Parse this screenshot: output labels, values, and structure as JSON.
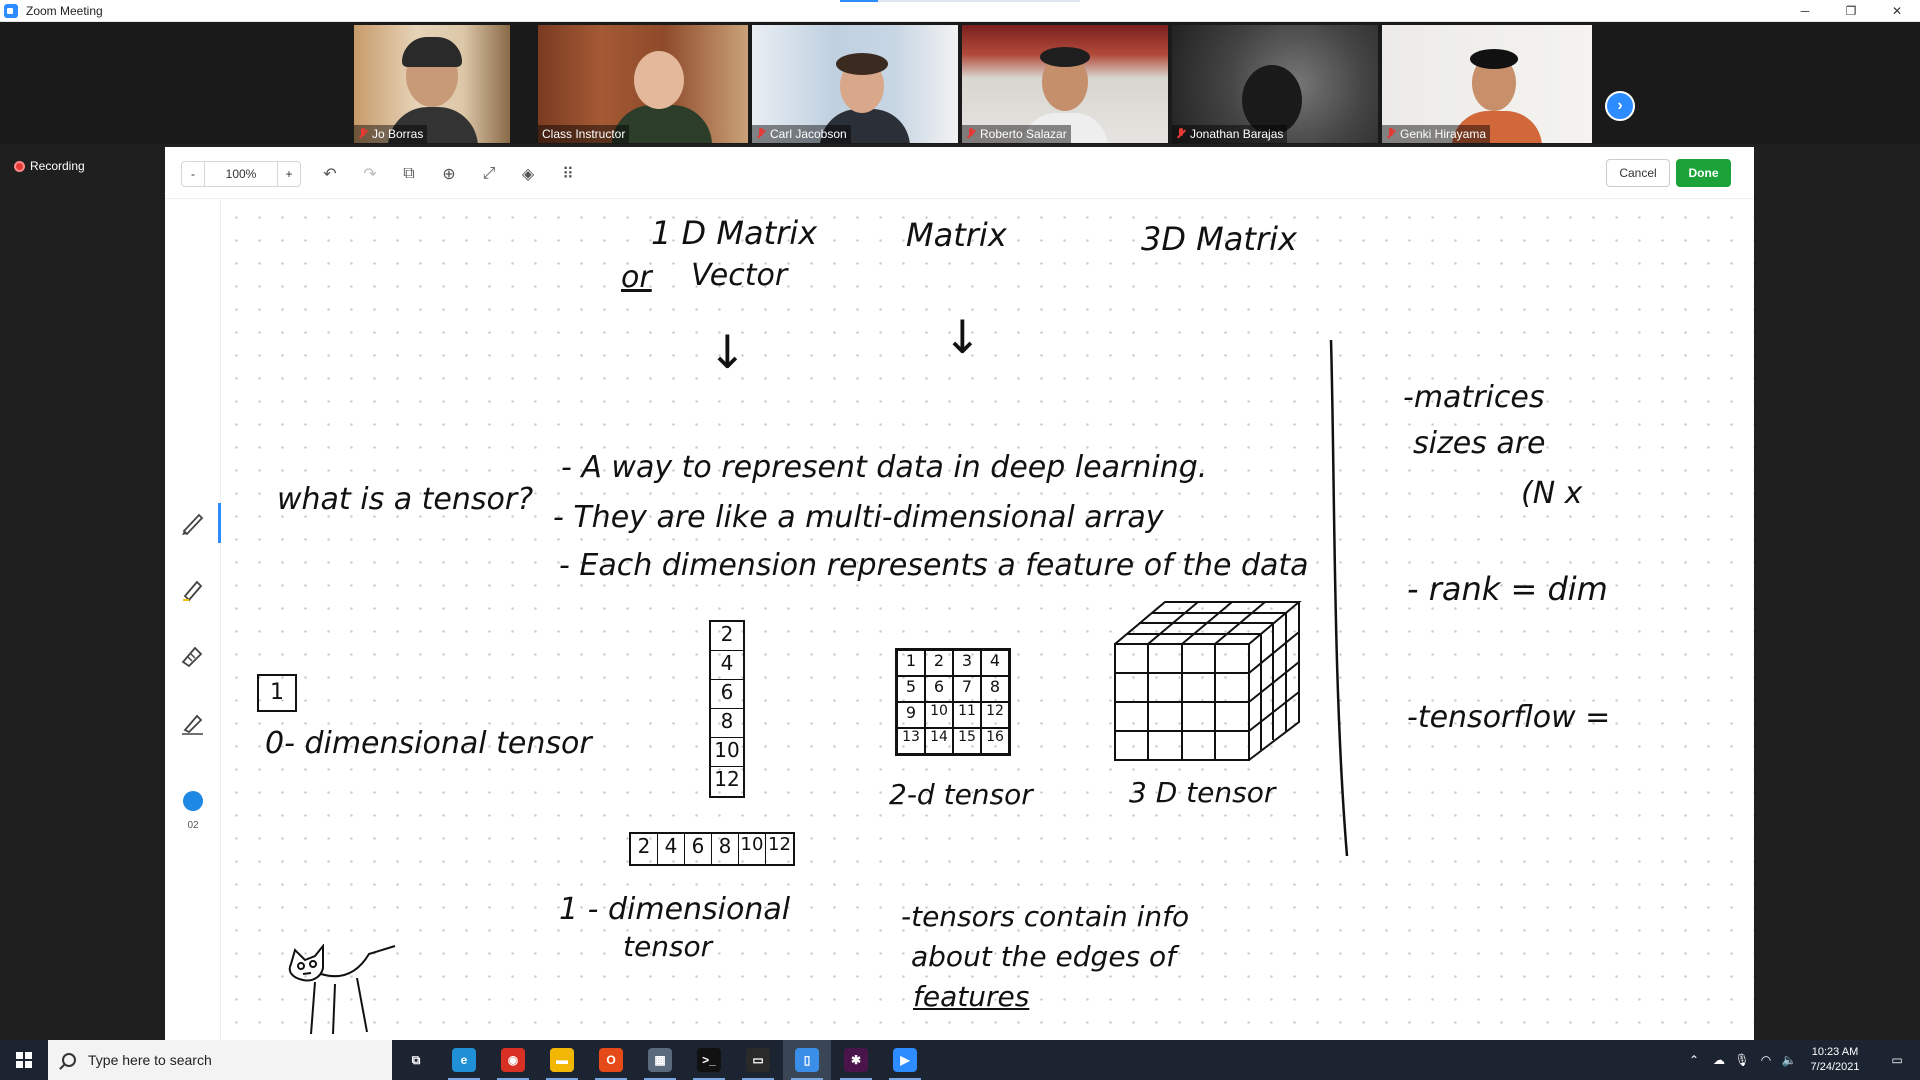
{
  "window": {
    "title": "Zoom Meeting",
    "loading_fraction": 0.16
  },
  "window_controls": {
    "minimize": "─",
    "restore": "❐",
    "close": "✕"
  },
  "participants": [
    {
      "name": "Jo Borras",
      "muted": true,
      "active": false
    },
    {
      "name": "Class Instructor",
      "muted": false,
      "active": true
    },
    {
      "name": "Carl Jacobson",
      "muted": true,
      "active": false
    },
    {
      "name": "Roberto Salazar",
      "muted": true,
      "active": false
    },
    {
      "name": "Jonathan Barajas",
      "muted": true,
      "active": false
    },
    {
      "name": "Genki Hirayama",
      "muted": true,
      "active": false
    }
  ],
  "gallery_next_icon": "chevron-right-icon",
  "recording": {
    "label": "Recording",
    "color": "#e53935"
  },
  "whiteboard": {
    "zoom": {
      "minus": "-",
      "value": "100%",
      "plus": "+"
    },
    "tools": [
      "undo-icon",
      "redo-icon",
      "shapes-icon",
      "laser-icon",
      "fit-screen-icon",
      "fill-icon",
      "grid-icon"
    ],
    "cancel_label": "Cancel",
    "done_label": "Done",
    "done_color": "#1ba33a",
    "pen_color": "#1e88e5",
    "pen_size": "02",
    "handwriting": {
      "heading_1d": "1 D Matrix",
      "heading_1d_or": "or",
      "heading_1d_vector": "Vector",
      "heading_2d": "Matrix",
      "heading_3d": "3D Matrix",
      "arrow": "↓",
      "q_what": "what is a tensor?",
      "a_1": "- A way to represent data in deep learning.",
      "a_2": "- They are like a multi-dimensional array",
      "a_3": "- Each dimension represents a feature of the data",
      "scalar_value": "1",
      "zero_d_label": "0- dimensional tensor",
      "column_values": [
        "2",
        "4",
        "6",
        "8",
        "10",
        "12"
      ],
      "row_values": [
        "2",
        "4",
        "6",
        "8",
        "10",
        "12"
      ],
      "one_d_label_1": "1 - dimensional",
      "one_d_label_2": "tensor",
      "grid_values": [
        "1",
        "2",
        "3",
        "4",
        "5",
        "6",
        "7",
        "8",
        "9",
        "10",
        "11",
        "12",
        "13",
        "14",
        "15",
        "16"
      ],
      "two_d_label": "2-d tensor",
      "three_d_label": "3 D tensor",
      "edges_1": "-tensors contain info",
      "edges_2": "about the edges of",
      "edges_3": "features",
      "right_1": "-matrices",
      "right_2": "sizes are",
      "right_3": "(N x",
      "right_4": "- rank = dim",
      "right_5": "-tensorflow ="
    }
  },
  "taskbar": {
    "search_placeholder": "Type here to search",
    "apps": [
      {
        "name": "task-view-icon",
        "glyph": "⧉",
        "color": "#1c2432"
      },
      {
        "name": "edge-icon",
        "glyph": "e",
        "color": "#1f8fd6"
      },
      {
        "name": "chrome-icon",
        "glyph": "◉",
        "color": "#d93025"
      },
      {
        "name": "file-explorer-icon",
        "glyph": "▬",
        "color": "#f2b705"
      },
      {
        "name": "office-icon",
        "glyph": "O",
        "color": "#e64a19"
      },
      {
        "name": "calculator-icon",
        "glyph": "▦",
        "color": "#5a6b7d"
      },
      {
        "name": "terminal-icon",
        "glyph": ">_",
        "color": "#111111"
      },
      {
        "name": "window-icon",
        "glyph": "▭",
        "color": "#2a2a2a"
      },
      {
        "name": "notepad-icon",
        "glyph": "▯",
        "color": "#3b8ee8"
      },
      {
        "name": "slack-icon",
        "glyph": "✱",
        "color": "#4a154b"
      },
      {
        "name": "zoom-icon",
        "glyph": "▶",
        "color": "#2d8cff"
      }
    ],
    "tray": [
      "chevron-up-icon",
      "onedrive-icon",
      "microphone-icon",
      "wifi-icon",
      "volume-icon"
    ],
    "time": "10:23 AM",
    "date": "7/24/2021",
    "notification_icon": "notification-icon"
  }
}
